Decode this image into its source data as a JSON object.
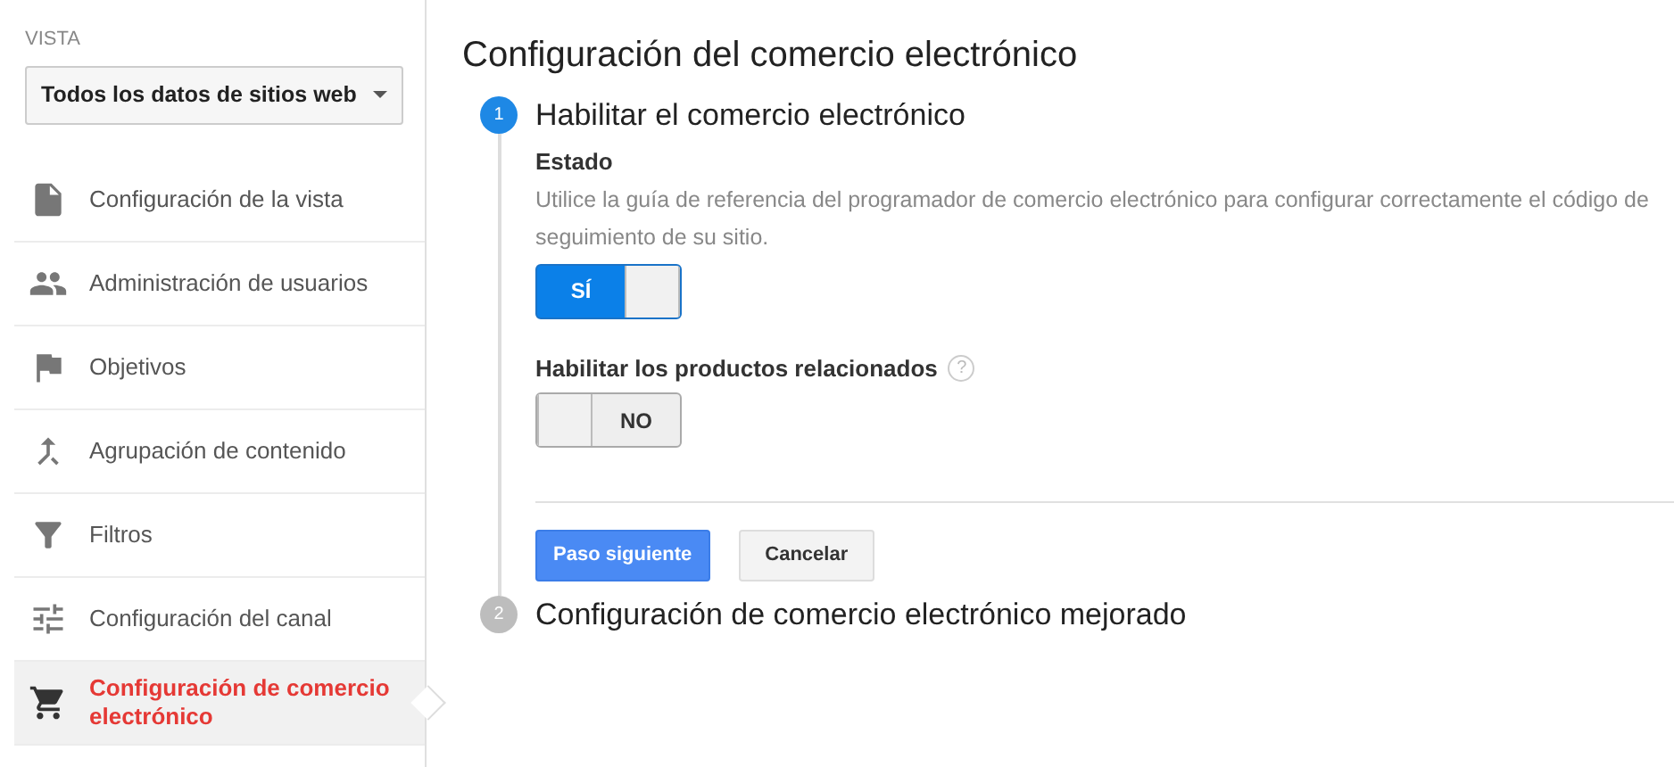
{
  "sidebar": {
    "view_label": "VISTA",
    "view_select": "Todos los datos de sitios web",
    "items": [
      {
        "label": "Configuración de la vista",
        "selected": false
      },
      {
        "label": "Administración de usuarios",
        "selected": false
      },
      {
        "label": "Objetivos",
        "selected": false
      },
      {
        "label": "Agrupación de contenido",
        "selected": false
      },
      {
        "label": "Filtros",
        "selected": false
      },
      {
        "label": "Configuración del canal",
        "selected": false
      },
      {
        "label": "Configuración de comercio electrónico",
        "selected": true
      }
    ]
  },
  "main": {
    "title": "Configuración del comercio electrónico",
    "steps": [
      {
        "number": "1",
        "title": "Habilitar el comercio electrónico",
        "active": true,
        "fields": [
          {
            "label": "Estado",
            "description": "Utilice la guía de referencia del programador de comercio electrónico para configurar correctamente el código de seguimiento de su sitio.",
            "toggle": {
              "on": true,
              "text": "SÍ"
            }
          },
          {
            "label": "Habilitar los productos relacionados",
            "help": "?",
            "toggle": {
              "on": false,
              "text": "NO"
            }
          }
        ],
        "buttons": [
          {
            "label": "Paso siguiente",
            "kind": "primary"
          },
          {
            "label": "Cancelar",
            "kind": "secondary"
          }
        ]
      },
      {
        "number": "2",
        "title": "Configuración de comercio electrónico mejorado",
        "active": false
      }
    ]
  }
}
